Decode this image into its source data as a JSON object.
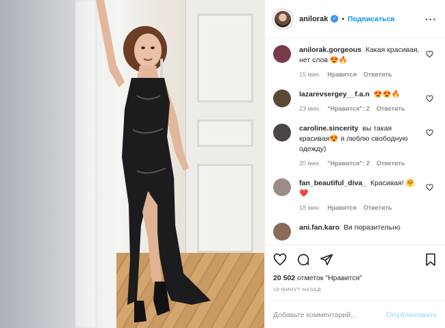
{
  "post": {
    "author": "anilorak",
    "follow_label": "Подписаться",
    "dot": "•",
    "more_icon": "more-dots-icon"
  },
  "comments": [
    {
      "user": "anilorak.gorgeous",
      "text": "Какая красивая, нет слов 😍🔥",
      "time": "15 мин.",
      "likes": "",
      "reply": "Нравится",
      "answer": "Ответить",
      "avatar_color": "#7a3b48"
    },
    {
      "user": "lazarevsergey__f.a.n",
      "text": "😍😍🔥",
      "time": "23 мин.",
      "likes": "\"Нравится\": 2",
      "reply": "",
      "answer": "Ответить",
      "avatar_color": "#5a4a34"
    },
    {
      "user": "caroline.sincerity",
      "text": "вы такая красивая😍 я люблю свободную одежду)",
      "time": "20 мин.",
      "likes": "\"Нравится\": 2",
      "reply": "",
      "answer": "Ответить",
      "avatar_color": "#4a4444"
    },
    {
      "user": "fan_beautiful_diva_",
      "text": "Красивая! 🤗❤️",
      "time": "18 мин.",
      "likes": "",
      "reply": "Нравится",
      "answer": "Ответить",
      "avatar_color": "#9a8d86"
    },
    {
      "user": "ani.fan.karo",
      "text": "Ви поразительно",
      "time": "",
      "likes": "",
      "reply": "",
      "answer": "",
      "avatar_color": "#8a6a5a"
    }
  ],
  "actions": {
    "likes_count": "20 502",
    "likes_word": "отметок \"Нравится\"",
    "posted": "18 минут назад"
  },
  "add_comment": {
    "placeholder": "Добавьте комментарий...",
    "publish": "Опубликовать"
  },
  "colors": {
    "accent": "#0095f6",
    "publish_disabled": "#b2dffc",
    "meta": "#8e8e8e"
  }
}
